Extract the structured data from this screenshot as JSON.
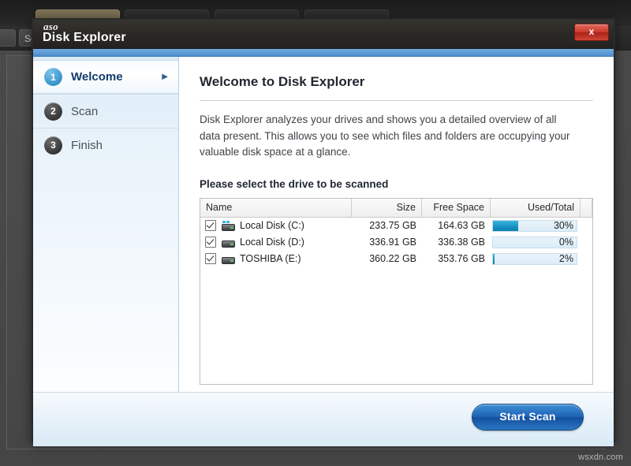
{
  "background": {
    "tabs": [
      "",
      "",
      "",
      ""
    ],
    "toolbar_buttons": [
      "×",
      "Se"
    ],
    "watermark": "wsxdn.com"
  },
  "dialog": {
    "brand": "aso",
    "title": "Disk Explorer",
    "close_label": "x"
  },
  "sidebar": {
    "steps": [
      {
        "num": "1",
        "label": "Welcome",
        "arrow": "▶",
        "active": true
      },
      {
        "num": "2",
        "label": "Scan",
        "arrow": "",
        "active": false
      },
      {
        "num": "3",
        "label": "Finish",
        "arrow": "",
        "active": false
      }
    ]
  },
  "content": {
    "heading": "Welcome to Disk Explorer",
    "intro": "Disk Explorer analyzes your drives and shows you a detailed overview of all data present.  This allows you to see which files and folders are occupying your valuable disk space at a glance.",
    "select_prompt": "Please select the drive to be scanned",
    "table": {
      "columns": [
        "Name",
        "Size",
        "Free Space",
        "Used/Total"
      ],
      "rows": [
        {
          "checked": true,
          "icon": "windows-drive-icon",
          "name": "Local Disk (C:)",
          "size": "233.75 GB",
          "free": "164.63 GB",
          "used_pct_label": "30%",
          "used_pct": 30
        },
        {
          "checked": true,
          "icon": "drive-icon",
          "name": "Local Disk (D:)",
          "size": "336.91 GB",
          "free": "336.38 GB",
          "used_pct_label": "0%",
          "used_pct": 0
        },
        {
          "checked": true,
          "icon": "drive-icon",
          "name": "TOSHIBA (E:)",
          "size": "360.22 GB",
          "free": "353.76 GB",
          "used_pct_label": "2%",
          "used_pct": 2
        }
      ]
    }
  },
  "footer": {
    "start_scan_label": "Start Scan"
  },
  "colors": {
    "accent_blue": "#5f9ad6",
    "button_blue": "#1e63b5",
    "progress_teal": "#1893c4",
    "close_red": "#cc3b2b",
    "active_step_text": "#123b6e"
  }
}
